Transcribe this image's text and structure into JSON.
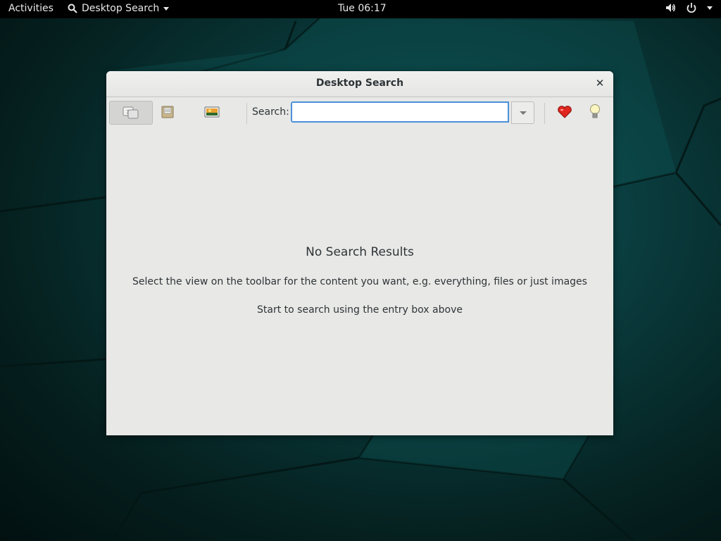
{
  "topbar": {
    "activities": "Activities",
    "app_menu": "Desktop Search",
    "clock": "Tue 06:17",
    "icons": [
      "volume-icon",
      "power-icon"
    ]
  },
  "window": {
    "title": "Desktop Search",
    "close_glyph": "✕",
    "toolbar": {
      "views": [
        "everything-view-icon",
        "files-view-icon",
        "images-view-icon"
      ],
      "active_view": "everything",
      "search_label": "Search:",
      "search_value": "",
      "actions": [
        "favorites-heart-icon",
        "tips-lightbulb-icon"
      ]
    },
    "empty_state": {
      "title": "No Search Results",
      "hint1": "Select the view on the toolbar for the content you want, e.g. everything, files or just images",
      "hint2": "Start to search using the entry box above"
    }
  },
  "colors": {
    "focus": "#4a90d9",
    "window_bg": "#e8e8e7",
    "topbar_bg": "#000000"
  }
}
